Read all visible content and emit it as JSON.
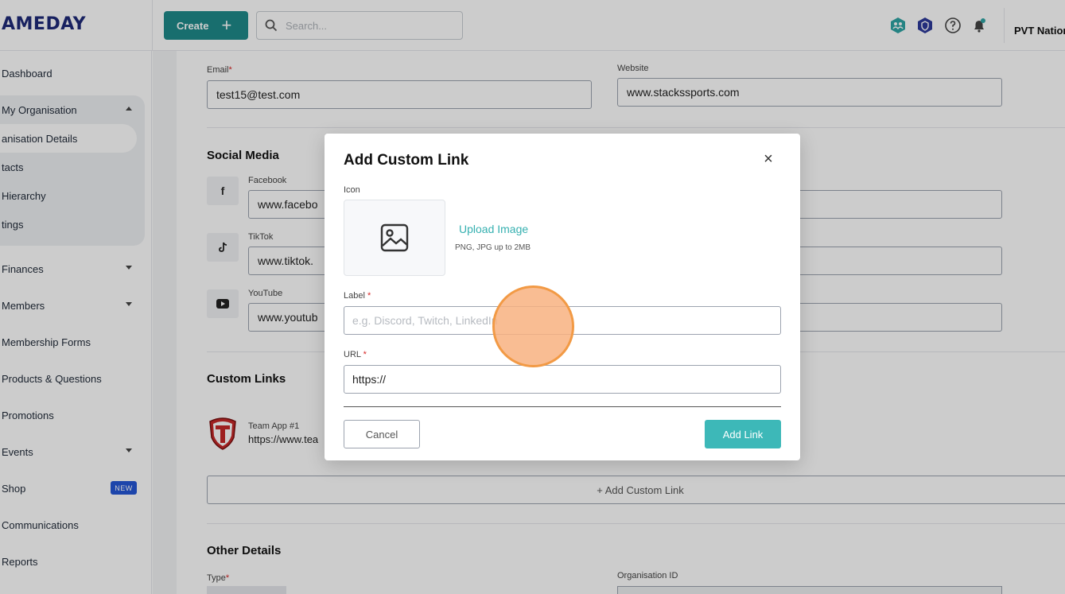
{
  "header": {
    "logo_text": "AMEDAY",
    "create_label": "Create",
    "search_placeholder": "Search...",
    "org_name": "PVT Nation"
  },
  "sidebar": {
    "items": [
      {
        "label": "Dashboard"
      },
      {
        "label": "My Organisation"
      },
      {
        "label": "anisation Details"
      },
      {
        "label": "tacts"
      },
      {
        "label": "Hierarchy"
      },
      {
        "label": "tings"
      },
      {
        "label": "Finances"
      },
      {
        "label": "Members"
      },
      {
        "label": "Membership Forms"
      },
      {
        "label": "Products & Questions"
      },
      {
        "label": "Promotions"
      },
      {
        "label": "Events"
      },
      {
        "label": "Shop"
      },
      {
        "label": "Communications"
      },
      {
        "label": "Reports"
      }
    ],
    "shop_badge": "NEW"
  },
  "main": {
    "email_label": "Email",
    "email_value": "test15@test.com",
    "website_label": "Website",
    "website_value": "www.stackssports.com",
    "social_title": "Social Media",
    "facebook_label": "Facebook",
    "facebook_value": "www.facebo",
    "tiktok_label": "TikTok",
    "tiktok_value": "www.tiktok.",
    "youtube_label": "YouTube",
    "youtube_value": "www.youtub",
    "custom_links_title": "Custom Links",
    "custom_link_name": "Team App #1",
    "custom_link_url": "https://www.tea",
    "add_custom_link": "+ Add Custom Link",
    "other_details_title": "Other Details",
    "type_label": "Type",
    "org_id_label": "Organisation ID"
  },
  "modal": {
    "title": "Add Custom Link",
    "icon_label": "Icon",
    "upload_link": "Upload Image",
    "upload_hint": "PNG, JPG up to 2MB",
    "label_label": "Label",
    "label_placeholder": "e.g. Discord, Twitch, LinkedIn",
    "url_label": "URL",
    "url_value": "https://",
    "cancel": "Cancel",
    "add": "Add Link"
  },
  "colors": {
    "brand_teal": "#1f8a8a",
    "accent_teal": "#3db8b8",
    "logo_navy": "#1e2a78",
    "required_red": "#d62828",
    "badge_blue": "#2557d6"
  }
}
